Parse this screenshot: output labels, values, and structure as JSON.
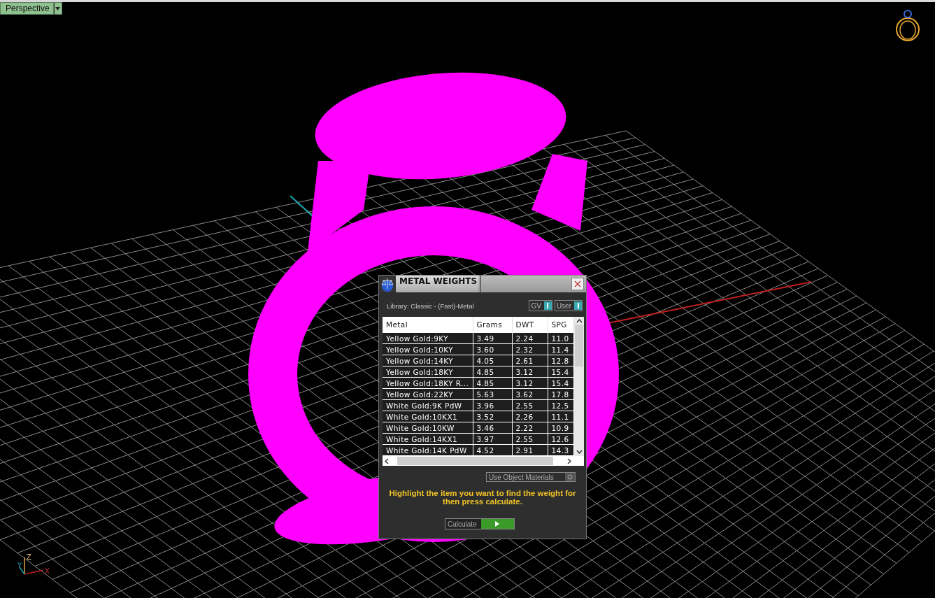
{
  "viewport": {
    "label": "Perspective",
    "axis_labels": [
      "Z",
      "Y",
      "X"
    ]
  },
  "dialog": {
    "title": "METAL WEIGHTS",
    "library": "Library: Classic - (Fast)-Metal",
    "toggles": [
      {
        "label": "GV",
        "on": true
      },
      {
        "label": "User",
        "on": true
      }
    ],
    "table": {
      "columns": [
        "Metal",
        "Grams",
        "DWT",
        "SPG"
      ],
      "rows": [
        [
          "Yellow Gold:9KY",
          "3.49",
          "2.24",
          "11.0"
        ],
        [
          "Yellow Gold:10KY",
          "3.60",
          "2.32",
          "11.4"
        ],
        [
          "Yellow Gold:14KY",
          "4.05",
          "2.61",
          "12.8"
        ],
        [
          "Yellow Gold:18KY",
          "4.85",
          "3.12",
          "15.4"
        ],
        [
          "Yellow Gold:18KY R...",
          "4.85",
          "3.12",
          "15.4"
        ],
        [
          "Yellow Gold:22KY",
          "5.63",
          "3.62",
          "17.8"
        ],
        [
          "White Gold:9K PdW",
          "3.96",
          "2.55",
          "12.5"
        ],
        [
          "White Gold:10KX1",
          "3.52",
          "2.26",
          "11.1"
        ],
        [
          "White Gold:10KW",
          "3.46",
          "2.22",
          "10.9"
        ],
        [
          "White Gold:14KX1",
          "3.97",
          "2.55",
          "12.6"
        ],
        [
          "White Gold:14K PdW",
          "4.52",
          "2.91",
          "14.3"
        ]
      ]
    },
    "use_object_materials": "Use Object Materials",
    "hint": "Highlight the item you want to find the weight for then press calculate.",
    "calculate": "Calculate"
  }
}
